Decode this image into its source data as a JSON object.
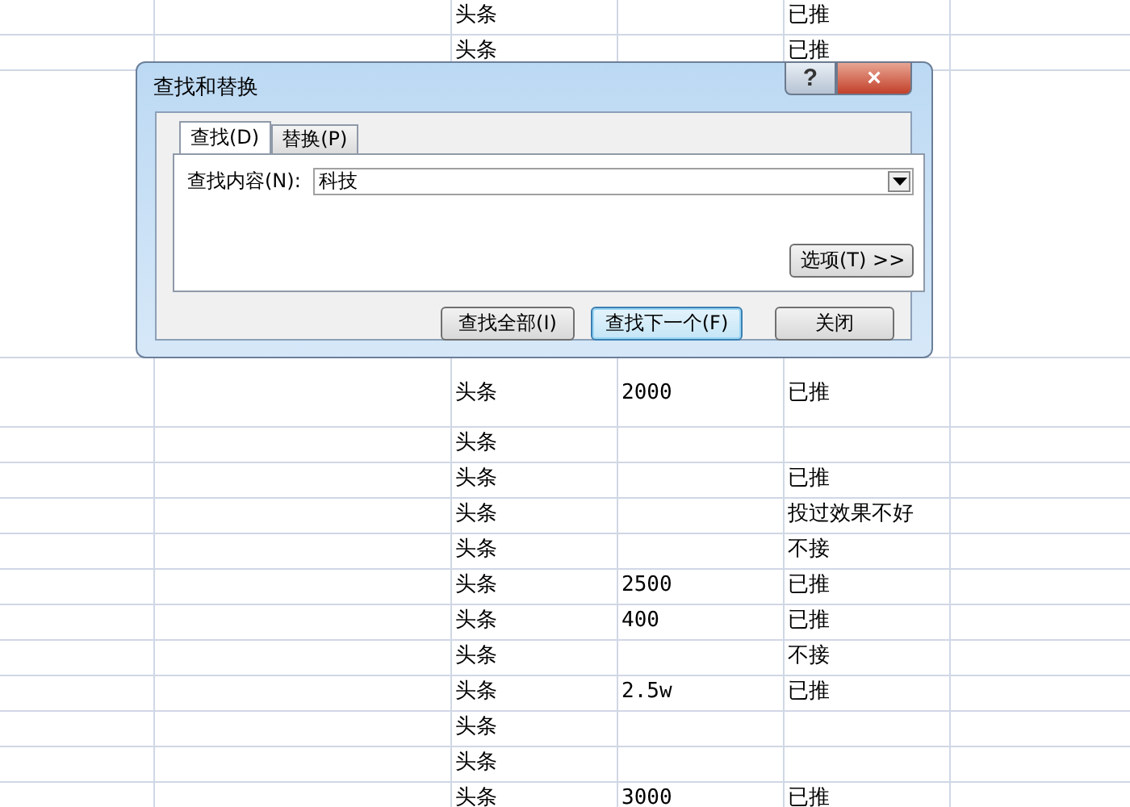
{
  "sheet": {
    "rows_above": [
      {
        "cells": [
          "头条",
          "",
          "已推"
        ]
      },
      {
        "cells": [
          "头条",
          "",
          "已推"
        ]
      }
    ],
    "rows_below": [
      {
        "cells": [
          "头条",
          "2000",
          "已推"
        ]
      },
      {
        "cells": [
          "头条",
          "",
          ""
        ]
      },
      {
        "cells": [
          "头条",
          "",
          "已推"
        ]
      },
      {
        "cells": [
          "头条",
          "",
          "投过效果不好"
        ]
      },
      {
        "cells": [
          "头条",
          "",
          "不接"
        ]
      },
      {
        "cells": [
          "头条",
          "2500",
          "已推"
        ]
      },
      {
        "cells": [
          "头条",
          "400",
          "已推"
        ]
      },
      {
        "cells": [
          "头条",
          "",
          "不接"
        ]
      },
      {
        "cells": [
          "头条",
          "2.5w",
          "已推"
        ]
      },
      {
        "cells": [
          "头条",
          "",
          ""
        ]
      },
      {
        "cells": [
          "头条",
          "",
          ""
        ]
      },
      {
        "cells": [
          "头条",
          "3000",
          "已推"
        ]
      }
    ]
  },
  "dialog": {
    "title": "查找和替换",
    "help": "?",
    "close": "×",
    "tabs": [
      {
        "label": "查找(D)",
        "selected": true
      },
      {
        "label": "替换(P)",
        "selected": false
      }
    ],
    "find_label": "查找内容(N):",
    "find_value": "科技",
    "options_button": "选项(T) >>",
    "buttons": [
      {
        "label": "查找全部(I)",
        "default": false
      },
      {
        "label": "查找下一个(F)",
        "default": true
      },
      {
        "label": "关闭",
        "default": false
      }
    ]
  }
}
